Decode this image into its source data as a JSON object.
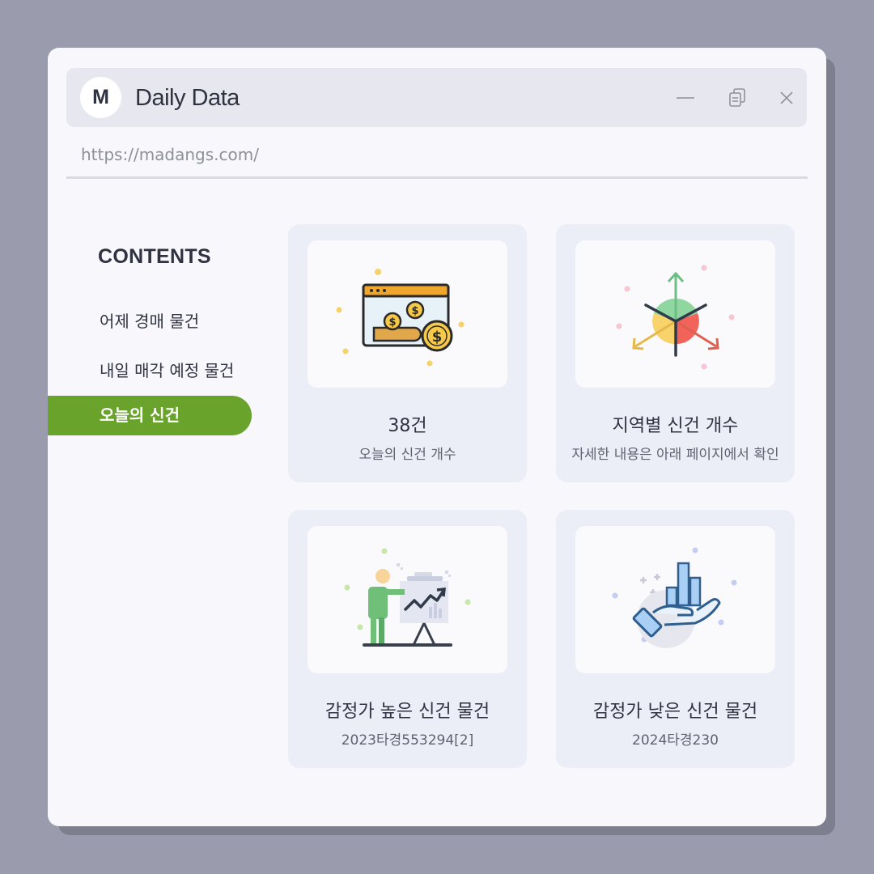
{
  "window": {
    "logo_letter": "M",
    "title": "Daily Data",
    "url": "https://madangs.com/"
  },
  "sidebar": {
    "title": "CONTENTS",
    "items": [
      {
        "label": "어제 경매 물건",
        "active": false
      },
      {
        "label": "내일 매각 예정 물건",
        "active": false
      },
      {
        "label": "오늘의 신건",
        "active": true
      }
    ]
  },
  "cards": [
    {
      "title": "38건",
      "subtitle": "오늘의 신건 개수",
      "icon": "money-browser-icon"
    },
    {
      "title": "지역별 신건 개수",
      "subtitle": "자세한 내용은 아래 페이지에서 확인",
      "icon": "distribution-arrows-icon"
    },
    {
      "title": "감정가 높은 신건 물건",
      "subtitle": "2023타경553294[2]",
      "icon": "presentation-chart-icon"
    },
    {
      "title": "감정가 낮은 신건 물건",
      "subtitle": "2024타경230",
      "icon": "hand-bar-chart-icon"
    }
  ],
  "colors": {
    "background": "#9a9cad",
    "window": "#f8f8fc",
    "titlebar": "#e6e7ef",
    "accent": "#6aa32b",
    "card": "#eceef7",
    "text": "#2f3240"
  }
}
